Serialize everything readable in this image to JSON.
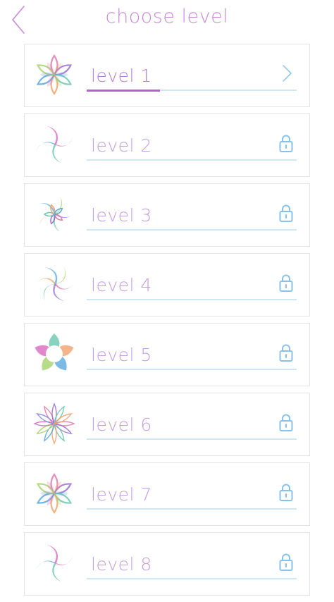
{
  "header": {
    "title": "choose level"
  },
  "colors": {
    "accent": "#c98ad8",
    "progress": "#b561cf",
    "track": "#cfe6f5",
    "lock": "#88c2ea",
    "label": "#b47fd3",
    "label_locked": "#c79ee0"
  },
  "levels": [
    {
      "label": "level 1",
      "locked": false,
      "progress": 0.35,
      "icon": "flower-star-icon",
      "status_icon": "chevron-right-icon"
    },
    {
      "label": "level 2",
      "locked": true,
      "progress": 0,
      "icon": "pinwheel-icon",
      "status_icon": "lock-icon"
    },
    {
      "label": "level 3",
      "locked": true,
      "progress": 0,
      "icon": "star-knot-icon",
      "status_icon": "lock-icon"
    },
    {
      "label": "level 4",
      "locked": true,
      "progress": 0,
      "icon": "spiral-pinwheel-icon",
      "status_icon": "lock-icon"
    },
    {
      "label": "level 5",
      "locked": true,
      "progress": 0,
      "icon": "petal-circle-icon",
      "status_icon": "lock-icon"
    },
    {
      "label": "level 6",
      "locked": true,
      "progress": 0,
      "icon": "rosette-icon",
      "status_icon": "lock-icon"
    },
    {
      "label": "level 7",
      "locked": true,
      "progress": 0,
      "icon": "flower-star-icon",
      "status_icon": "lock-icon"
    },
    {
      "label": "level 8",
      "locked": true,
      "progress": 0,
      "icon": "pinwheel-icon",
      "status_icon": "lock-icon"
    }
  ]
}
